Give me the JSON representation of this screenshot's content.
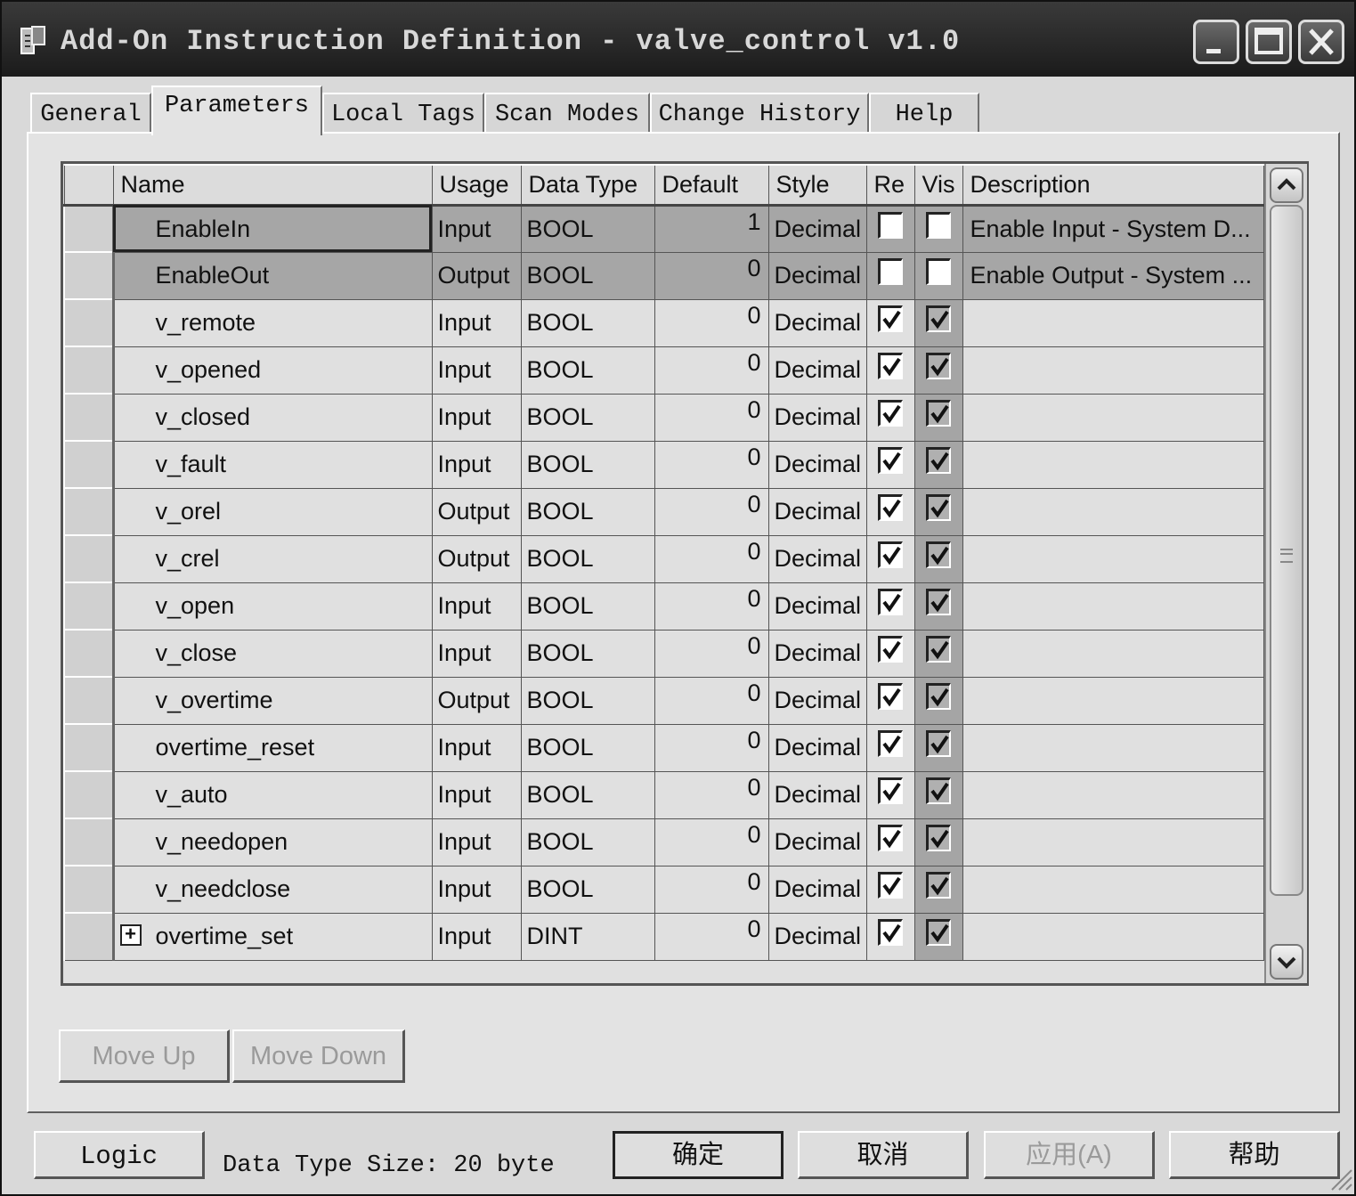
{
  "window": {
    "title": "Add-On Instruction Definition - valve_control v1.0"
  },
  "tabs": [
    {
      "label": "General"
    },
    {
      "label": "Parameters"
    },
    {
      "label": "Local Tags"
    },
    {
      "label": "Scan Modes"
    },
    {
      "label": "Change History"
    },
    {
      "label": "Help"
    }
  ],
  "active_tab": "Parameters",
  "grid": {
    "columns": [
      "Name",
      "Usage",
      "Data Type",
      "Default",
      "Style",
      "Re",
      "Vis",
      "Description"
    ],
    "rows": [
      {
        "name": "EnableIn",
        "usage": "Input",
        "data_type": "BOOL",
        "default": "1",
        "style": "Decimal",
        "req": false,
        "vis": false,
        "description": "Enable Input - System D..."
      },
      {
        "name": "EnableOut",
        "usage": "Output",
        "data_type": "BOOL",
        "default": "0",
        "style": "Decimal",
        "req": false,
        "vis": false,
        "description": "Enable Output - System ..."
      },
      {
        "name": "v_remote",
        "usage": "Input",
        "data_type": "BOOL",
        "default": "0",
        "style": "Decimal",
        "req": true,
        "vis": true,
        "description": ""
      },
      {
        "name": "v_opened",
        "usage": "Input",
        "data_type": "BOOL",
        "default": "0",
        "style": "Decimal",
        "req": true,
        "vis": true,
        "description": ""
      },
      {
        "name": "v_closed",
        "usage": "Input",
        "data_type": "BOOL",
        "default": "0",
        "style": "Decimal",
        "req": true,
        "vis": true,
        "description": ""
      },
      {
        "name": "v_fault",
        "usage": "Input",
        "data_type": "BOOL",
        "default": "0",
        "style": "Decimal",
        "req": true,
        "vis": true,
        "description": ""
      },
      {
        "name": "v_orel",
        "usage": "Output",
        "data_type": "BOOL",
        "default": "0",
        "style": "Decimal",
        "req": true,
        "vis": true,
        "description": ""
      },
      {
        "name": "v_crel",
        "usage": "Output",
        "data_type": "BOOL",
        "default": "0",
        "style": "Decimal",
        "req": true,
        "vis": true,
        "description": ""
      },
      {
        "name": "v_open",
        "usage": "Input",
        "data_type": "BOOL",
        "default": "0",
        "style": "Decimal",
        "req": true,
        "vis": true,
        "description": ""
      },
      {
        "name": "v_close",
        "usage": "Input",
        "data_type": "BOOL",
        "default": "0",
        "style": "Decimal",
        "req": true,
        "vis": true,
        "description": ""
      },
      {
        "name": "v_overtime",
        "usage": "Output",
        "data_type": "BOOL",
        "default": "0",
        "style": "Decimal",
        "req": true,
        "vis": true,
        "description": ""
      },
      {
        "name": "overtime_reset",
        "usage": "Input",
        "data_type": "BOOL",
        "default": "0",
        "style": "Decimal",
        "req": true,
        "vis": true,
        "description": ""
      },
      {
        "name": "v_auto",
        "usage": "Input",
        "data_type": "BOOL",
        "default": "0",
        "style": "Decimal",
        "req": true,
        "vis": true,
        "description": ""
      },
      {
        "name": "v_needopen",
        "usage": "Input",
        "data_type": "BOOL",
        "default": "0",
        "style": "Decimal",
        "req": true,
        "vis": true,
        "description": ""
      },
      {
        "name": "v_needclose",
        "usage": "Input",
        "data_type": "BOOL",
        "default": "0",
        "style": "Decimal",
        "req": true,
        "vis": true,
        "description": ""
      },
      {
        "name": "overtime_set",
        "usage": "Input",
        "data_type": "DINT",
        "default": "0",
        "style": "Decimal",
        "req": true,
        "vis": true,
        "description": "",
        "expandable": true
      }
    ]
  },
  "buttons": {
    "move_up": "Move Up",
    "move_down": "Move Down",
    "logic": "Logic",
    "ok": "确定",
    "cancel": "取消",
    "apply": "应用(A)",
    "help": "帮助"
  },
  "status": {
    "data_type_size": "Data Type Size: 20 byte"
  },
  "icons": {
    "window_icon": "aoi-app-icon",
    "minimize": "minimize-icon",
    "maximize": "maximize-icon",
    "close": "close-icon",
    "scroll_up": "chevron-up-icon",
    "scroll_down": "chevron-down-icon",
    "expand": "plus-expand-icon",
    "checkbox": "checkbox-icon"
  }
}
